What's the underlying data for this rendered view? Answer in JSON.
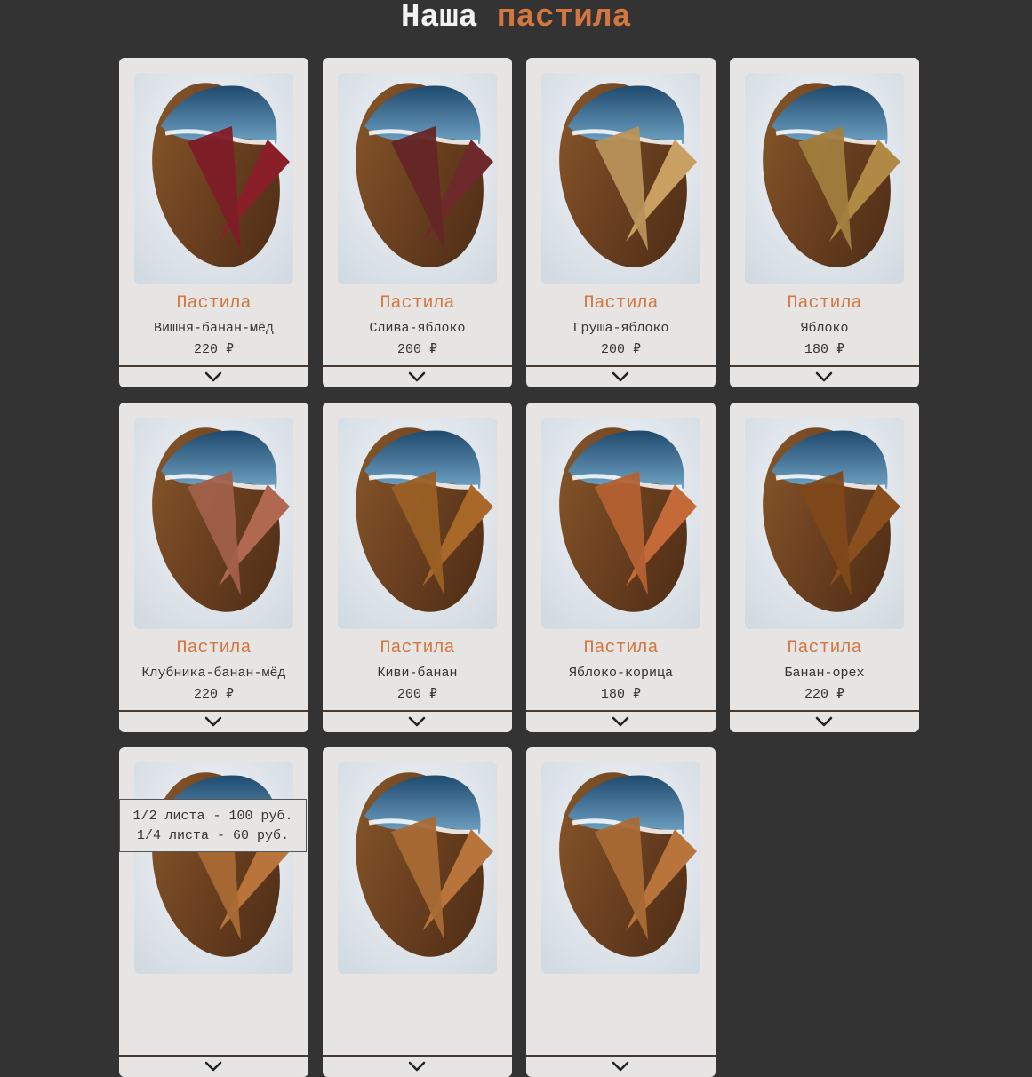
{
  "header": {
    "title_prefix": "Наша",
    "title_accent": "пастила"
  },
  "colors": {
    "accent": "#d4763f",
    "background": "#333333",
    "card": "#e6e5e4"
  },
  "products": [
    {
      "title": "Пастила",
      "flavor": "Вишня-банан-мёд",
      "price": "220 ₽",
      "color": "#8a1f2a"
    },
    {
      "title": "Пастила",
      "flavor": "Слива-яблоко",
      "price": "200 ₽",
      "color": "#6e2a2a"
    },
    {
      "title": "Пастила",
      "flavor": "Груша-яблоко",
      "price": "200 ₽",
      "color": "#c9a062"
    },
    {
      "title": "Пастила",
      "flavor": "Яблоко",
      "price": "180 ₽",
      "color": "#b08a45"
    },
    {
      "title": "Пастила",
      "flavor": "Клубника-банан-мёд",
      "price": "220 ₽",
      "color": "#b06850"
    },
    {
      "title": "Пастила",
      "flavor": "Киви-банан",
      "price": "200 ₽",
      "color": "#a86828"
    },
    {
      "title": "Пастила",
      "flavor": "Яблоко-корица",
      "price": "180 ₽",
      "color": "#c46a38"
    },
    {
      "title": "Пастила",
      "flavor": "Банан-орех",
      "price": "220 ₽",
      "color": "#8a4f1c"
    },
    {
      "title": "",
      "flavor": "",
      "price": "",
      "color": ""
    },
    {
      "title": "",
      "flavor": "",
      "price": "",
      "color": ""
    },
    {
      "title": "",
      "flavor": "",
      "price": "",
      "color": ""
    }
  ],
  "popup": {
    "line1": "1/2 листа - 100 руб.",
    "line2": "1/4 листа - 60 руб."
  },
  "icons": {
    "expand": "chevron-down-icon"
  }
}
